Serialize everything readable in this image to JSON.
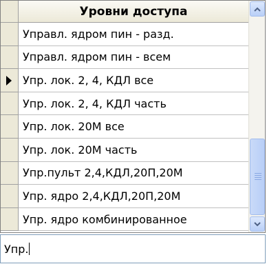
{
  "table": {
    "header": "Уровни доступа",
    "rows": [
      "Управл. ядром пин - разд.",
      "Управл. ядром пин - всем",
      "Упр. лок. 2, 4, КДЛ все",
      "Упр. лок. 2, 4, КДЛ часть",
      "Упр. лок. 20М все",
      "Упр. лок. 20М часть",
      "Упр.пульт 2,4,КДЛ,20П,20М",
      "Упр. ядро 2,4,КДЛ,20П,20М",
      "Упр. ядро комбинированное"
    ],
    "current_row_index": 2
  },
  "search": {
    "value": "Упр."
  },
  "scrollbar": {
    "up_icon": "chevron-up-icon",
    "down_icon": "chevron-down-icon"
  }
}
